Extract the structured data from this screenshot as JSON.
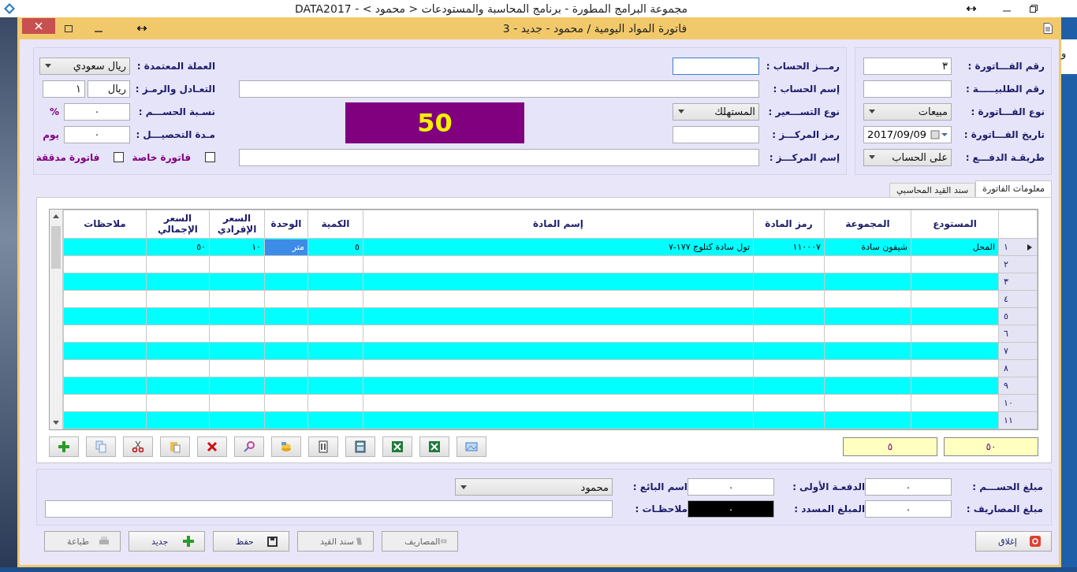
{
  "app": {
    "title": "مجموعة البرامج المطورة - برنامج المحاسبة والمستودعات < محمود > - DATA2017"
  },
  "dialog": {
    "title": "فاتورة المواد اليومية / محمود - جديد - 3"
  },
  "side_tab": {
    "label": "و"
  },
  "invoice_fields": [
    {
      "label": "رقم الفـــاتورة :",
      "kind": "text",
      "value": "٣"
    },
    {
      "label": "رقم الطلبيـــــة :",
      "kind": "text"
    },
    {
      "label": "نوع الفـــاتورة :",
      "kind": "select",
      "value": "مبيعات"
    },
    {
      "label": "تاريخ الفـــاتورة :",
      "kind": "date",
      "value": "2017/09/09"
    },
    {
      "label": "طريقـة الدفـــع :",
      "kind": "select",
      "value": "على الحساب"
    }
  ],
  "account_fields": [
    {
      "label": "رمـــز الحساب :",
      "kind": "text",
      "focused": true
    },
    {
      "label": "إسم الحساب :",
      "kind": "wide"
    },
    {
      "label": "نوع التســـعير :",
      "kind": "select",
      "value": "المستهلك"
    },
    {
      "label": "رمز المركـــز :",
      "kind": "text"
    },
    {
      "label": "إسم المركـــز :",
      "kind": "wide"
    }
  ],
  "total_display": "50",
  "currency_fields": [
    {
      "label": "العملة المعتمدة :",
      "kind": "select",
      "value": "ريال سعودي"
    },
    {
      "label": "التعـادل والرمـز :",
      "kind": "pair",
      "values": [
        "ريال",
        "١"
      ]
    },
    {
      "label": "نسـبة الحســـم :",
      "kind": "unit",
      "value": "٠",
      "unit": "%"
    },
    {
      "label": "مـدة التحصيـــل :",
      "kind": "unit",
      "value": "٠",
      "unit": "يوم"
    }
  ],
  "checkboxes": [
    {
      "label": "فاتورة خاصة",
      "checked": false
    },
    {
      "label": "فاتورة مدققة",
      "checked": false
    }
  ],
  "tabs": [
    {
      "label": "معلومات الفاتورة",
      "selected": true
    },
    {
      "label": "سند القيد المحاسبي",
      "selected": false
    }
  ],
  "table": {
    "columns": [
      "المستودع",
      "المجموعة",
      "رمز المادة",
      "إسم المادة",
      "الكمية",
      "الوحدة",
      "السعر الإفرادي",
      "السعر الإجمالي",
      "ملاحظات"
    ],
    "rows": [
      {
        "number": "١",
        "current": true,
        "cells": [
          {
            "text": "المحل",
            "selected": false
          },
          {
            "text": "شيفون سادة",
            "selected": false
          },
          {
            "text": "١١٠٠٠٧",
            "selected": false
          },
          {
            "text": "تول سادة  كتلوج ١٧٧-٧",
            "selected": false
          },
          {
            "text": "٥",
            "selected": false
          },
          {
            "text": "متر",
            "selected": true
          },
          {
            "text": "١٠",
            "selected": false
          },
          {
            "text": "٥٠",
            "selected": false
          }
        ]
      },
      {
        "number": "٢",
        "current": false
      },
      {
        "number": "٣",
        "current": false
      },
      {
        "number": "٤",
        "current": false
      },
      {
        "number": "٥",
        "current": false
      },
      {
        "number": "٦",
        "current": false
      },
      {
        "number": "٧",
        "current": false
      },
      {
        "number": "٨",
        "current": false
      },
      {
        "number": "٩",
        "current": false
      },
      {
        "number": "١٠",
        "current": false
      },
      {
        "number": "١١",
        "current": false
      }
    ]
  },
  "totals": [
    "٥٠",
    "٥"
  ],
  "summary_fields": [
    {
      "label": "مبلغ الحســـم :",
      "kind": "text",
      "value": "٠"
    },
    {
      "label": "الدفعـة الأولى :",
      "kind": "text",
      "value": "٠"
    },
    {
      "label": "اسم البائع :",
      "kind": "select",
      "value": "محمود"
    },
    {
      "label": "مبلغ المصاريف :",
      "kind": "text",
      "value": "٠"
    },
    {
      "label": "المبلغ المسدد :",
      "kind": "dark",
      "value": "٠"
    },
    {
      "label": "ملاحظـات :",
      "kind": "wide"
    }
  ],
  "buttons": [
    {
      "label": "إغلاق",
      "disabled": false
    },
    {
      "label": "المصاريف",
      "disabled": true
    },
    {
      "label": "سند القيد",
      "disabled": true
    },
    {
      "label": "حفظ",
      "disabled": false
    },
    {
      "label": "جديد",
      "disabled": false
    },
    {
      "label": "طباعة",
      "disabled": true
    }
  ]
}
